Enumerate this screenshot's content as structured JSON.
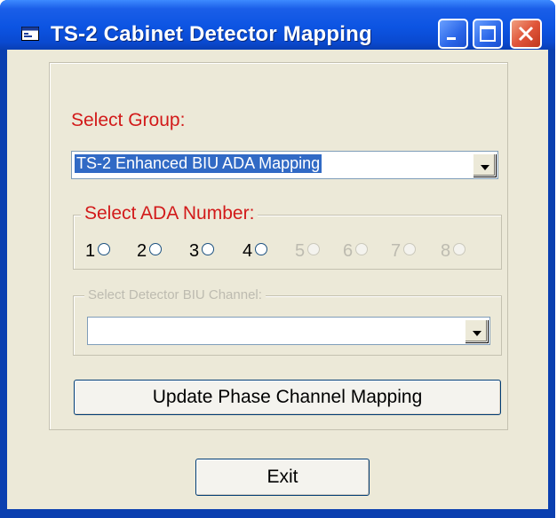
{
  "window": {
    "title": "TS-2 Cabinet Detector Mapping"
  },
  "group": {
    "label": "Select Group:",
    "selected": "TS-2 Enhanced BIU ADA Mapping"
  },
  "ada": {
    "caption": "Select ADA Number:",
    "options": [
      {
        "label": "1",
        "enabled": true
      },
      {
        "label": "2",
        "enabled": true
      },
      {
        "label": "3",
        "enabled": true
      },
      {
        "label": "4",
        "enabled": true
      },
      {
        "label": "5",
        "enabled": false
      },
      {
        "label": "6",
        "enabled": false
      },
      {
        "label": "7",
        "enabled": false
      },
      {
        "label": "8",
        "enabled": false
      }
    ]
  },
  "biu": {
    "caption": "Select Detector BIU Channel:",
    "selected": ""
  },
  "buttons": {
    "update": "Update Phase Channel Mapping",
    "exit": "Exit"
  },
  "colors": {
    "accent_red": "#d21a1a",
    "titlebar_blue": "#0c54e2",
    "face": "#ece9d8",
    "selection": "#316ac5"
  }
}
